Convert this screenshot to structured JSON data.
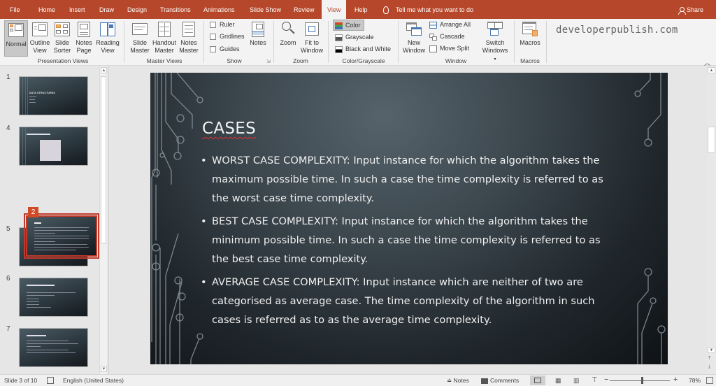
{
  "tabs": [
    {
      "label": "File"
    },
    {
      "label": "Home"
    },
    {
      "label": "Insert"
    },
    {
      "label": "Draw"
    },
    {
      "label": "Design"
    },
    {
      "label": "Transitions"
    },
    {
      "label": "Animations"
    },
    {
      "label": "Slide Show"
    },
    {
      "label": "Review"
    },
    {
      "label": "View",
      "active": true
    },
    {
      "label": "Help"
    }
  ],
  "tell_me": "Tell me what you want to do",
  "share": "Share",
  "ribbon": {
    "presentation_views": {
      "label": "Presentation Views",
      "buttons": [
        {
          "l1": "Normal",
          "l2": "",
          "selected": true
        },
        {
          "l1": "Outline",
          "l2": "View"
        },
        {
          "l1": "Slide",
          "l2": "Sorter"
        },
        {
          "l1": "Notes",
          "l2": "Page"
        },
        {
          "l1": "Reading",
          "l2": "View"
        }
      ]
    },
    "master_views": {
      "label": "Master Views",
      "buttons": [
        {
          "l1": "Slide",
          "l2": "Master"
        },
        {
          "l1": "Handout",
          "l2": "Master"
        },
        {
          "l1": "Notes",
          "l2": "Master"
        }
      ]
    },
    "show": {
      "label": "Show",
      "checkboxes": [
        {
          "label": "Ruler",
          "checked": false
        },
        {
          "label": "Gridlines",
          "checked": false
        },
        {
          "label": "Guides",
          "checked": false
        }
      ],
      "notes": "Notes"
    },
    "zoom": {
      "label": "Zoom",
      "zoom_btn": "Zoom",
      "fit_l1": "Fit to",
      "fit_l2": "Window"
    },
    "color_grayscale": {
      "label": "Color/Grayscale",
      "options": [
        {
          "label": "Color",
          "selected": true
        },
        {
          "label": "Grayscale"
        },
        {
          "label": "Black and White"
        }
      ]
    },
    "window": {
      "label": "Window",
      "new_l1": "New",
      "new_l2": "Window",
      "arrange_all": "Arrange All",
      "cascade": "Cascade",
      "move_split": "Move Split",
      "switch_l1": "Switch",
      "switch_l2": "Windows"
    },
    "macros": {
      "label": "Macros",
      "button": "Macros"
    }
  },
  "watermark": "developerpublish.com",
  "thumbnails": [
    {
      "number": "1",
      "title": "DATA STRUCTURES"
    },
    {
      "number": "4",
      "title": "DIAGRAM SLIDE"
    },
    {
      "number": "5",
      "title": "CASES",
      "selected": true,
      "drag_badge": "2"
    },
    {
      "number": "6",
      "title": "INTRODUCTION TO ARRAYS"
    },
    {
      "number": "7",
      "title": "ARRAY OPERATIONS"
    }
  ],
  "slide": {
    "title": "CASES",
    "bullets": [
      "WORST CASE COMPLEXITY: Input instance for which the algorithm takes the maximum possible time. In such a case the time complexity is referred to as the worst case time complexity.",
      "BEST CASE COMPLEXITY: Input  instance for which the algorithm takes the minimum possible time. In such a case the time complexity is referred to as the best case time complexity.",
      "AVERAGE CASE COMPLEXITY: Input instance which are neither of two are categorised as average case. The time complexity of the algorithm in such cases is referred as to as the average time complexity."
    ]
  },
  "status": {
    "slide_info": "Slide 3 of 10",
    "language": "English (United States)",
    "notes": "Notes",
    "comments": "Comments",
    "zoom_level": "78%",
    "zoom_percent": 78
  }
}
